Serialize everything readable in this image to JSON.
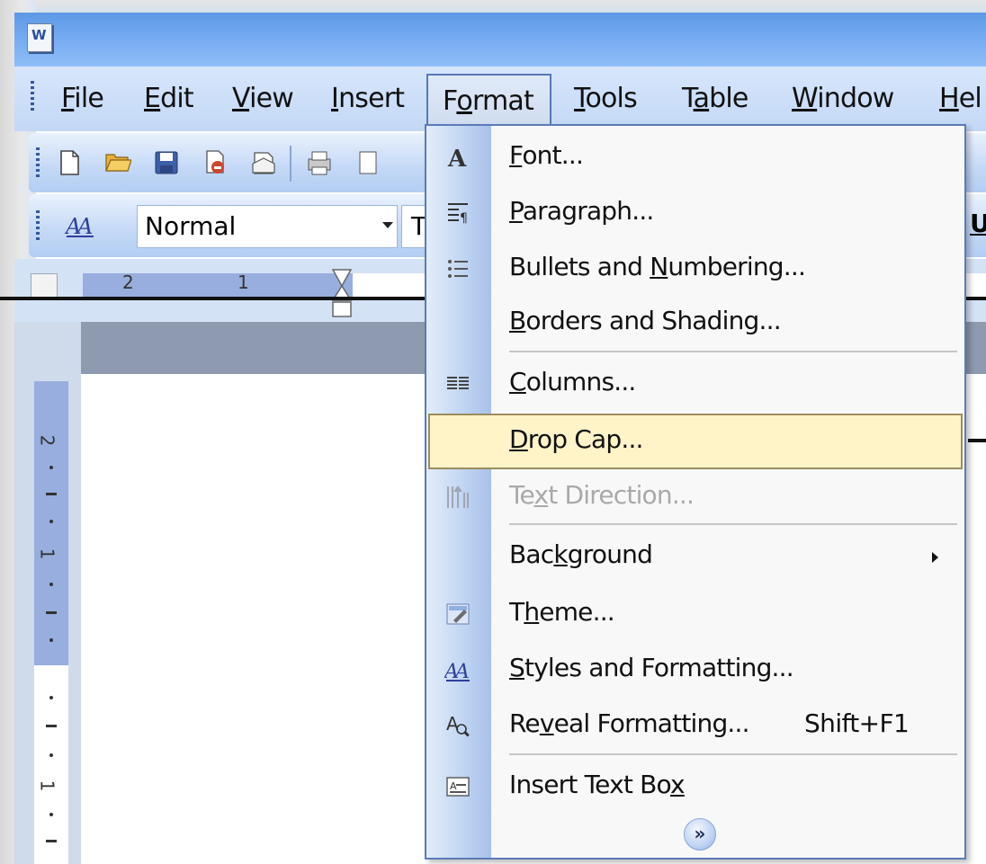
{
  "app": {
    "icon_letter": "W",
    "menubar": {
      "items": [
        {
          "label": "File",
          "u": "F",
          "rest": "ile"
        },
        {
          "label": "Edit",
          "u": "E",
          "rest": "dit"
        },
        {
          "label": "View",
          "u": "V",
          "rest": "iew"
        },
        {
          "label": "Insert",
          "pre": "",
          "u": "I",
          "rest": "nsert"
        },
        {
          "label": "Format",
          "pre": "F",
          "u": "o",
          "rest": "rmat"
        },
        {
          "label": "Tools",
          "u": "T",
          "rest": "ools"
        },
        {
          "label": "Table",
          "pre": "T",
          "u": "a",
          "rest": "ble"
        },
        {
          "label": "Window",
          "u": "W",
          "rest": "indow"
        },
        {
          "label": "Hel",
          "u": "H",
          "rest": "el"
        }
      ]
    },
    "formatting_toolbar": {
      "style_value": "Normal",
      "font_value": "Tin",
      "right_clip": "U"
    },
    "ruler": {
      "left_marks": "2",
      "mid_marks": "1"
    },
    "vertical_ruler": {
      "numbers": [
        "2",
        "1",
        "1"
      ]
    }
  },
  "format_menu": {
    "items": [
      {
        "name": "font",
        "pre": "",
        "u": "F",
        "rest": "ont...",
        "icon": "font-A-icon",
        "enabled": true
      },
      {
        "name": "paragraph",
        "pre": "",
        "u": "P",
        "rest": "aragraph...",
        "icon": "paragraph-icon",
        "enabled": true
      },
      {
        "name": "bullets",
        "pre": "Bullets and ",
        "u": "N",
        "rest": "umbering...",
        "icon": "bullets-icon",
        "enabled": true
      },
      {
        "name": "borders",
        "pre": "",
        "u": "B",
        "rest": "orders and Shading...",
        "icon": "",
        "enabled": true
      },
      {
        "name": "columns",
        "pre": "",
        "u": "C",
        "rest": "olumns...",
        "icon": "columns-icon",
        "enabled": true
      },
      {
        "name": "drop-cap",
        "pre": "",
        "u": "D",
        "rest": "rop Cap...",
        "icon": "",
        "enabled": true,
        "highlighted": true
      },
      {
        "name": "text-direction",
        "pre": "Te",
        "u": "x",
        "rest": "t Direction...",
        "icon": "text-direction-icon",
        "enabled": false
      },
      {
        "name": "background",
        "pre": "Bac",
        "u": "k",
        "rest": "ground",
        "icon": "",
        "enabled": true,
        "submenu": true
      },
      {
        "name": "theme",
        "pre": "T",
        "u": "h",
        "rest": "eme...",
        "icon": "theme-icon",
        "enabled": true
      },
      {
        "name": "styles",
        "pre": "",
        "u": "S",
        "rest": "tyles and Formatting...",
        "icon": "styles-icon",
        "enabled": true
      },
      {
        "name": "reveal",
        "pre": "Re",
        "u": "v",
        "rest": "eal Formatting...",
        "icon": "reveal-formatting-icon",
        "enabled": true,
        "shortcut": "Shift+F1"
      },
      {
        "name": "text-box",
        "pre": "Insert Text Bo",
        "u": "x",
        "rest": "",
        "icon": "text-box-icon",
        "enabled": true
      }
    ],
    "expand_glyph": "»"
  },
  "colors": {
    "titlebar": "#74aaf1",
    "menubar": "#c9dcf7",
    "highlight_fill": "#fff3c8",
    "highlight_border": "#9b8c5e",
    "menu_border": "#5b7bb8"
  }
}
